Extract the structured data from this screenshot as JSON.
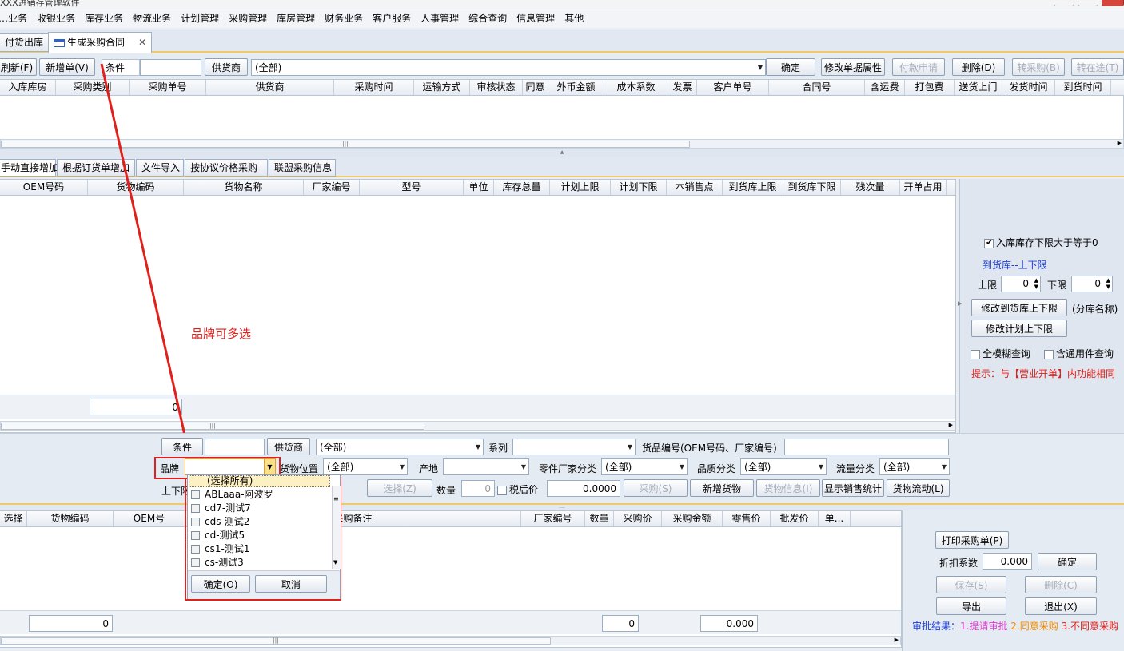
{
  "app": {
    "title": "XXX进销存管理软件"
  },
  "menu": [
    "…业务",
    "收银业务",
    "库存业务",
    "物流业务",
    "计划管理",
    "采购管理",
    "库房管理",
    "财务业务",
    "客户服务",
    "人事管理",
    "综合查询",
    "信息管理",
    "其他"
  ],
  "doc_tabs": [
    {
      "label": "付货出库"
    },
    {
      "label": "生成采购合同",
      "close": "✕"
    }
  ],
  "toolbar": {
    "refresh": "刷新(F)",
    "new": "新增单(V)",
    "cond_label": "条件",
    "cond_value": "",
    "supplier_label": "供货商",
    "supplier_value": "(全部)",
    "confirm": "确定",
    "modify_attr": "修改单据属性",
    "pay_apply": "付款申请",
    "delete": "删除(D)",
    "to_purchase": "转采购(B)",
    "to_transit": "转在途(T)"
  },
  "top_grid": {
    "columns": [
      "入库库房",
      "采购类别",
      "采购单号",
      "供货商",
      "采购时间",
      "运输方式",
      "审核状态",
      "同意",
      "外币金额",
      "成本系数",
      "发票",
      "客户单号",
      "合同号",
      "含运费",
      "打包费",
      "送货上门",
      "发货时间",
      "到货时间"
    ]
  },
  "mid_tabs": [
    "手动直接增加",
    "根据订货单增加",
    "文件导入",
    "按协议价格采购",
    "联盟采购信息"
  ],
  "mid_grid": {
    "columns": [
      "OEM号码",
      "货物编码",
      "货物名称",
      "厂家编号",
      "型号",
      "单位",
      "库存总量",
      "计划上限",
      "计划下限",
      "本销售点",
      "到货库上限",
      "到货库下限",
      "残次量",
      "开单占用"
    ],
    "footer_value": "0"
  },
  "annotation": {
    "text": "品牌可多选"
  },
  "right_panel": {
    "chk_label": "入库库存下限大于等于0",
    "link": "到货库--上下限",
    "upper_label": "上限",
    "upper_value": "0",
    "lower_label": "下限",
    "lower_value": "0",
    "btn_modify_store": "修改到货库上下限",
    "store_name": "(分库名称)",
    "btn_modify_plan": "修改计划上下限",
    "fuzzy": "全模糊查询",
    "common": "含通用件查询",
    "hint": "提示：与【营业开单】内功能相同"
  },
  "filter": {
    "cond_btn": "条件",
    "cond_value": "",
    "supplier_btn": "供货商",
    "supplier_value": "(全部)",
    "series_label": "系列",
    "series_value": "",
    "goods_code_label": "货品编号(OEM号码、厂家编号)",
    "goods_code_value": "",
    "brand_label": "品牌",
    "brand_value": "",
    "location_label": "货物位置",
    "location_value": "(全部)",
    "origin_label": "产地",
    "origin_value": "",
    "part_cat_label": "零件厂家分类",
    "part_cat_value": "(全部)",
    "quality_label": "品质分类",
    "quality_value": "(全部)",
    "flow_label": "流量分类",
    "flow_value": "(全部)",
    "updown_label": "上下限",
    "select_btn": "选择(Z)",
    "qty_label": "数量",
    "qty_value": "0",
    "tax_label": "税后价",
    "price_value": "0.0000",
    "purchase_btn": "采购(S)",
    "add_goods": "新增货物",
    "goods_info": "货物信息(I)",
    "sales_stats": "显示销售统计",
    "goods_flow": "货物流动(L)"
  },
  "brand_dropdown": {
    "select_all": "(选择所有)",
    "items": [
      "ABLaaa-阿波罗",
      "cd7-测试7",
      "cds-测试2",
      "cd-测试5",
      "cs1-测试1",
      "cs-测试3"
    ],
    "ok": "确定(O)",
    "cancel": "取消"
  },
  "bottom_grid": {
    "columns": [
      "选择",
      "货物编码",
      "OEM号",
      "采购备注",
      "厂家编号",
      "数量",
      "采购价",
      "采购金额",
      "零售价",
      "批发价",
      "单..."
    ],
    "footer_code": "0",
    "footer_qty": "0",
    "footer_amount": "0.000"
  },
  "bottom_right": {
    "print": "打印采购单(P)",
    "discount_label": "折扣系数",
    "discount_value": "0.000",
    "confirm": "确定",
    "save": "保存(S)",
    "delete": "删除(C)",
    "export": "导出",
    "exit": "退出(X)",
    "approval_label": "审批结果：",
    "approval_1": "1.提请审批",
    "approval_2": "2.同意采购",
    "approval_3": "3.不同意采购"
  },
  "colors": {
    "accent_red": "#e0201b",
    "link_blue": "#1c3fd6",
    "orange": "#f08a00"
  }
}
